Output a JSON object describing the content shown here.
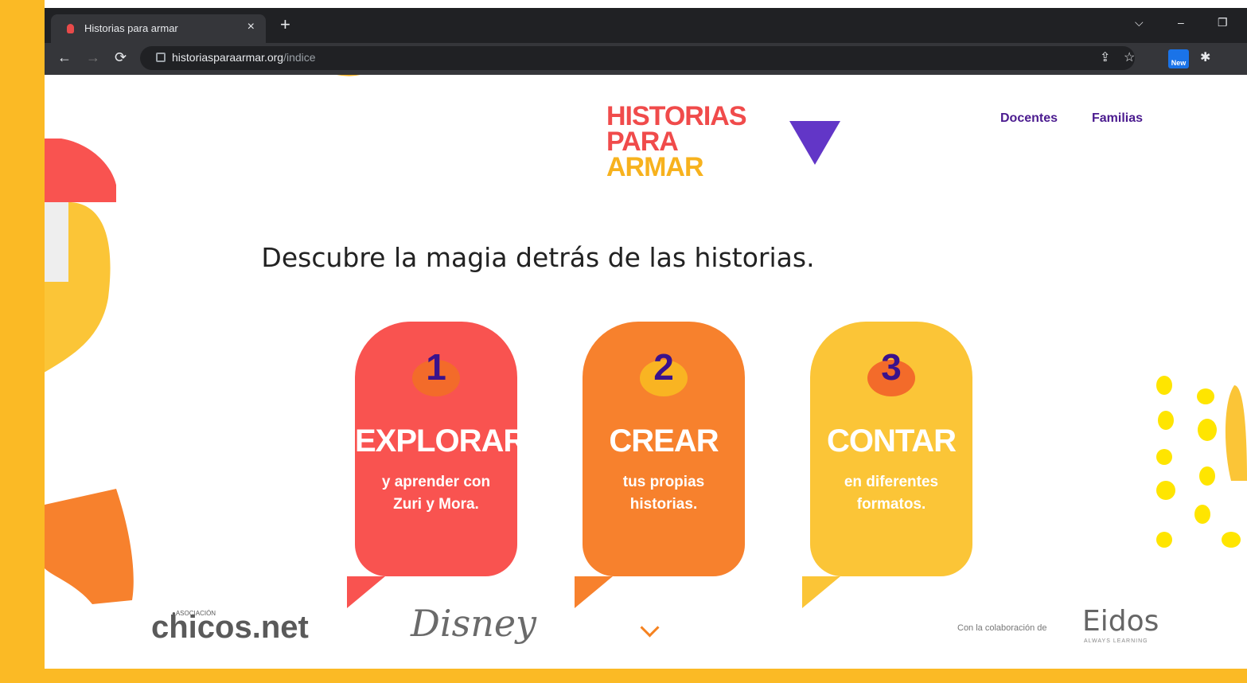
{
  "browser": {
    "tab_title": "Historias para armar",
    "tab_close": "×",
    "new_tab": "+",
    "url_host": "historiasparaarmar.org",
    "url_path": "/indice",
    "extension_badge": "New",
    "window_controls": [
      "⌵",
      "–",
      "❐"
    ]
  },
  "logo": {
    "line1": "HISTORIAS",
    "line2": "PARA",
    "line3": "ARMAR"
  },
  "nav": {
    "docentes": "Docentes",
    "familias": "Familias"
  },
  "headline": "Descubre la magia detrás de las historias.",
  "cards": [
    {
      "number": "1",
      "title": "EXPLORAR",
      "subtitle_1": "y aprender con",
      "subtitle_2": "Zuri y Mora.",
      "color": "#F95350",
      "blob": "#F36B2A"
    },
    {
      "number": "2",
      "title": "CREAR",
      "subtitle_1": "tus propias",
      "subtitle_2": "historias.",
      "color": "#F7812D",
      "blob": "#F9B422"
    },
    {
      "number": "3",
      "title": "CONTAR",
      "subtitle_1": "en diferentes",
      "subtitle_2": "formatos.",
      "color": "#FBC537",
      "blob": "#F36B2A"
    }
  ],
  "footer": {
    "chicos_top": "●ASOCIACIÓN",
    "chicos": "chicos.net",
    "disney": "Disney",
    "collab": "Con la colaboración de",
    "eidos": "Eidos",
    "eidos_tag": "ALWAYS LEARNING"
  },
  "colors": {
    "frame": "#FBBA25",
    "nav_text": "#4B1B8F",
    "triangle": "#6236C7"
  }
}
